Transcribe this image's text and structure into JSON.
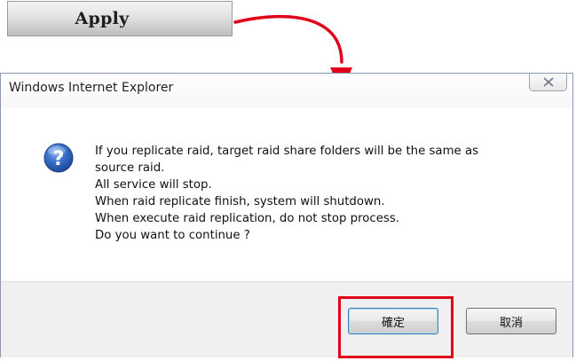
{
  "apply_button": {
    "label": "Apply"
  },
  "dialog": {
    "title": "Windows Internet Explorer",
    "close_glyph": "X",
    "icon": "question-icon",
    "message_lines": [
      "If you replicate raid, target raid share folders will be the same as",
      "source raid.",
      "All service will stop.",
      "When raid replicate finish, system will shutdown.",
      "When execute raid replication, do not stop process.",
      "Do you want to continue ?"
    ],
    "ok_label": "確定",
    "cancel_label": "取消"
  },
  "annotations": {
    "arrow_icon": "curved-arrow-icon",
    "highlight_color": "#e0001a"
  },
  "colors": {
    "dialog_border": "#8a9ab0",
    "footer_bg": "#f0f0f0",
    "ok_border": "#3c7fb1",
    "icon_blue": "#2f64b6"
  }
}
